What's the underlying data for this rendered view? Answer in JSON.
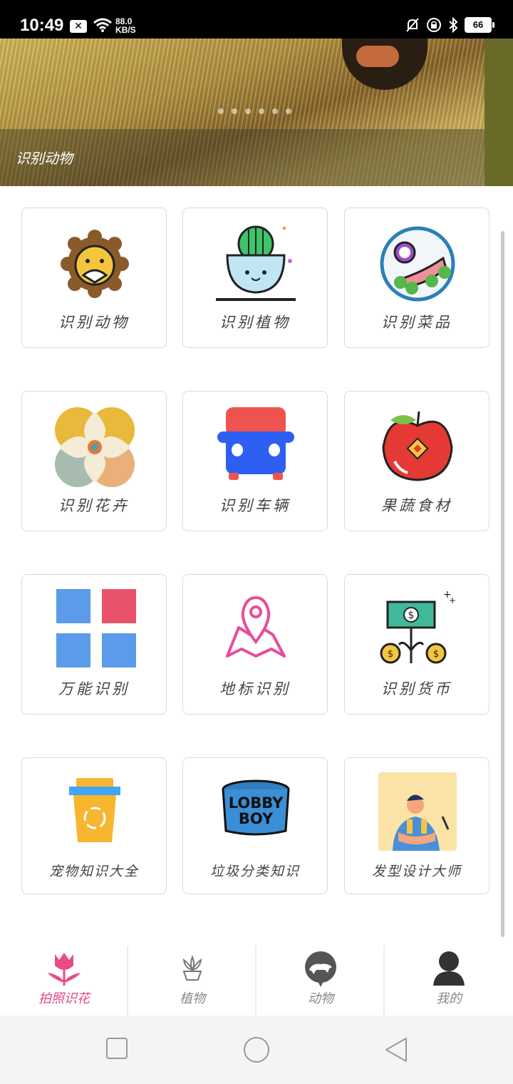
{
  "status_bar": {
    "time": "10:49",
    "speed_value": "88.0",
    "speed_unit": "KB/S",
    "battery": "66"
  },
  "banner": {
    "caption": "识别动物",
    "dot_count": 6
  },
  "grid": {
    "items": [
      {
        "label": "识别动物",
        "icon": "lion-icon"
      },
      {
        "label": "识别植物",
        "icon": "cactus-icon"
      },
      {
        "label": "识别菜品",
        "icon": "dish-icon"
      },
      {
        "label": "识别花卉",
        "icon": "flower-icon"
      },
      {
        "label": "识别车辆",
        "icon": "vehicle-icon"
      },
      {
        "label": "果蔬食材",
        "icon": "apple-icon"
      },
      {
        "label": "万能识别",
        "icon": "grid-squares-icon"
      },
      {
        "label": "地标识别",
        "icon": "map-pin-icon"
      },
      {
        "label": "识别货币",
        "icon": "money-plant-icon"
      },
      {
        "label": "宠物知识大全",
        "icon": "recycle-bin-icon"
      },
      {
        "label": "垃圾分类知识",
        "icon": "lobby-boy-hat-icon"
      },
      {
        "label": "发型设计大师",
        "icon": "barber-icon"
      }
    ]
  },
  "bottom_nav": {
    "items": [
      {
        "label": "拍照识花",
        "icon": "tulip-icon",
        "active": true
      },
      {
        "label": "植物",
        "icon": "potted-plant-icon",
        "active": false
      },
      {
        "label": "动物",
        "icon": "animal-bubble-icon",
        "active": false
      },
      {
        "label": "我的",
        "icon": "user-icon",
        "active": false
      }
    ]
  },
  "colors": {
    "accent": "#e04a86",
    "card_border": "#d9d9d9",
    "label": "#444444"
  }
}
